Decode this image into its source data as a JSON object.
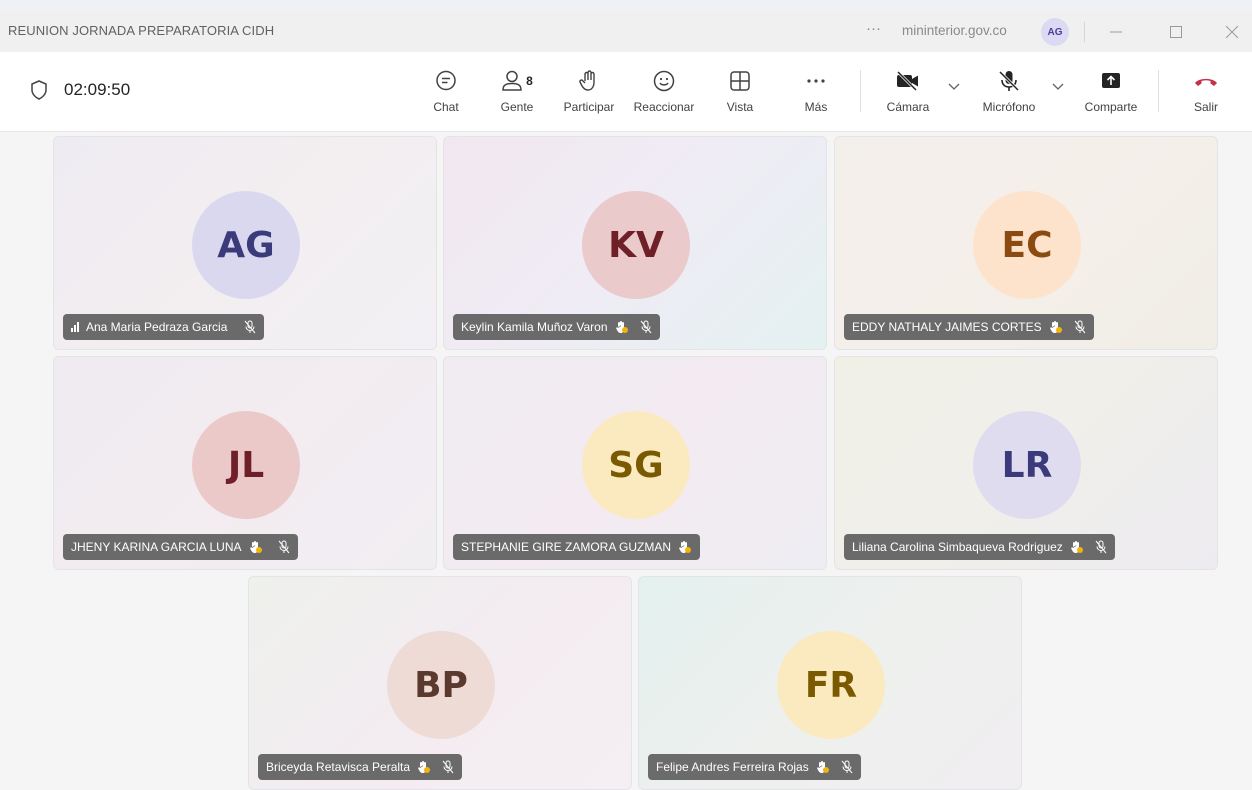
{
  "window": {
    "title": "REUNION JORNADA PREPARATORIA CIDH",
    "more_dots": "···",
    "org": "mininterior.gov.co",
    "user_initials": "AG"
  },
  "toolbar": {
    "timer": "02:09:50",
    "buttons": {
      "chat": "Chat",
      "people": "Gente",
      "people_count": "8",
      "raise": "Participar",
      "react": "Reaccionar",
      "view": "Vista",
      "more": "Más",
      "camera": "Cámara",
      "mic": "Micrófono",
      "share": "Comparte",
      "leave": "Salir"
    }
  },
  "participants": [
    {
      "initials": "AG",
      "name": "Ana Maria Pedraza Garcia",
      "signal": true,
      "raised": false,
      "muted": true
    },
    {
      "initials": "KV",
      "name": "Keylin Kamila Muñoz Varon",
      "signal": false,
      "raised": true,
      "muted": true
    },
    {
      "initials": "EC",
      "name": "EDDY NATHALY JAIMES CORTES",
      "signal": false,
      "raised": true,
      "muted": true
    },
    {
      "initials": "JL",
      "name": "JHENY KARINA GARCIA LUNA",
      "signal": false,
      "raised": true,
      "muted": true
    },
    {
      "initials": "SG",
      "name": "STEPHANIE GIRE ZAMORA GUZMAN",
      "signal": false,
      "raised": true,
      "muted": false
    },
    {
      "initials": "LR",
      "name": "Liliana Carolina Simbaqueva Rodriguez",
      "signal": false,
      "raised": true,
      "muted": true
    },
    {
      "initials": "BP",
      "name": "Briceyda Retavisca Peralta",
      "signal": false,
      "raised": true,
      "muted": true
    },
    {
      "initials": "FR",
      "name": "Felipe Andres Ferreira Rojas",
      "signal": false,
      "raised": true,
      "muted": true
    }
  ],
  "colors": {
    "leave_red": "#c4314b",
    "avatar_AG_bg": "#d9d8ef",
    "avatar_AG_fg": "#3b3a7a",
    "avatar_KV_bg": "#eacaca",
    "avatar_KV_fg": "#6e1f28",
    "avatar_EC_bg": "#fde3cb",
    "avatar_EC_fg": "#8a4a12",
    "avatar_JL_bg": "#ecc9c9",
    "avatar_JL_fg": "#6e1f28",
    "avatar_SG_bg": "#fbeac0",
    "avatar_SG_fg": "#7a5a00",
    "avatar_LR_bg": "#e0dcf0",
    "avatar_LR_fg": "#3b3a7a",
    "avatar_BP_bg": "#eedbd5",
    "avatar_BP_fg": "#5a3a2e",
    "avatar_FR_bg": "#fbeac0",
    "avatar_FR_fg": "#7a5a00"
  }
}
